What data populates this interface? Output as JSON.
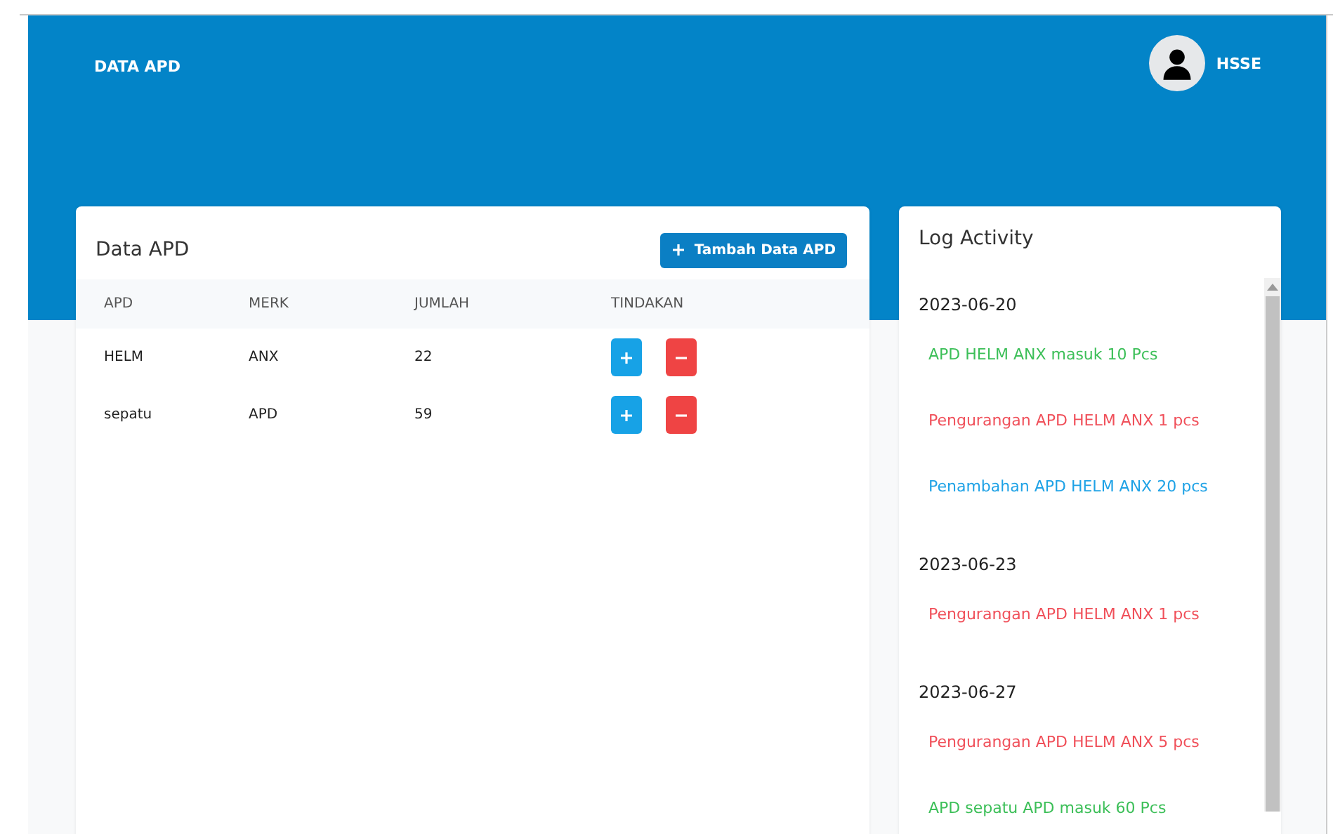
{
  "header": {
    "title": "DATA APD",
    "user": "HSSE"
  },
  "apd_card": {
    "title": "Data APD",
    "add_button": "Tambah Data APD",
    "columns": [
      "APD",
      "MERK",
      "JUMLAH",
      "TINDAKAN"
    ],
    "rows": [
      {
        "apd": "HELM",
        "merk": "ANX",
        "jumlah": "22"
      },
      {
        "apd": "sepatu",
        "merk": "APD",
        "jumlah": "59"
      }
    ]
  },
  "log_card": {
    "title": "Log Activity",
    "groups": [
      {
        "date": "2023-06-20",
        "entries": [
          {
            "text": "APD HELM ANX masuk 10 Pcs",
            "kind": "in"
          },
          {
            "text": "Pengurangan APD HELM ANX 1 pcs",
            "kind": "out"
          },
          {
            "text": "Penambahan APD HELM ANX 20 pcs",
            "kind": "add"
          }
        ]
      },
      {
        "date": "2023-06-23",
        "entries": [
          {
            "text": "Pengurangan APD HELM ANX 1 pcs",
            "kind": "out"
          }
        ]
      },
      {
        "date": "2023-06-27",
        "entries": [
          {
            "text": "Pengurangan APD HELM ANX 5 pcs",
            "kind": "out"
          },
          {
            "text": "APD sepatu APD masuk 60 Pcs",
            "kind": "in"
          }
        ]
      }
    ]
  }
}
